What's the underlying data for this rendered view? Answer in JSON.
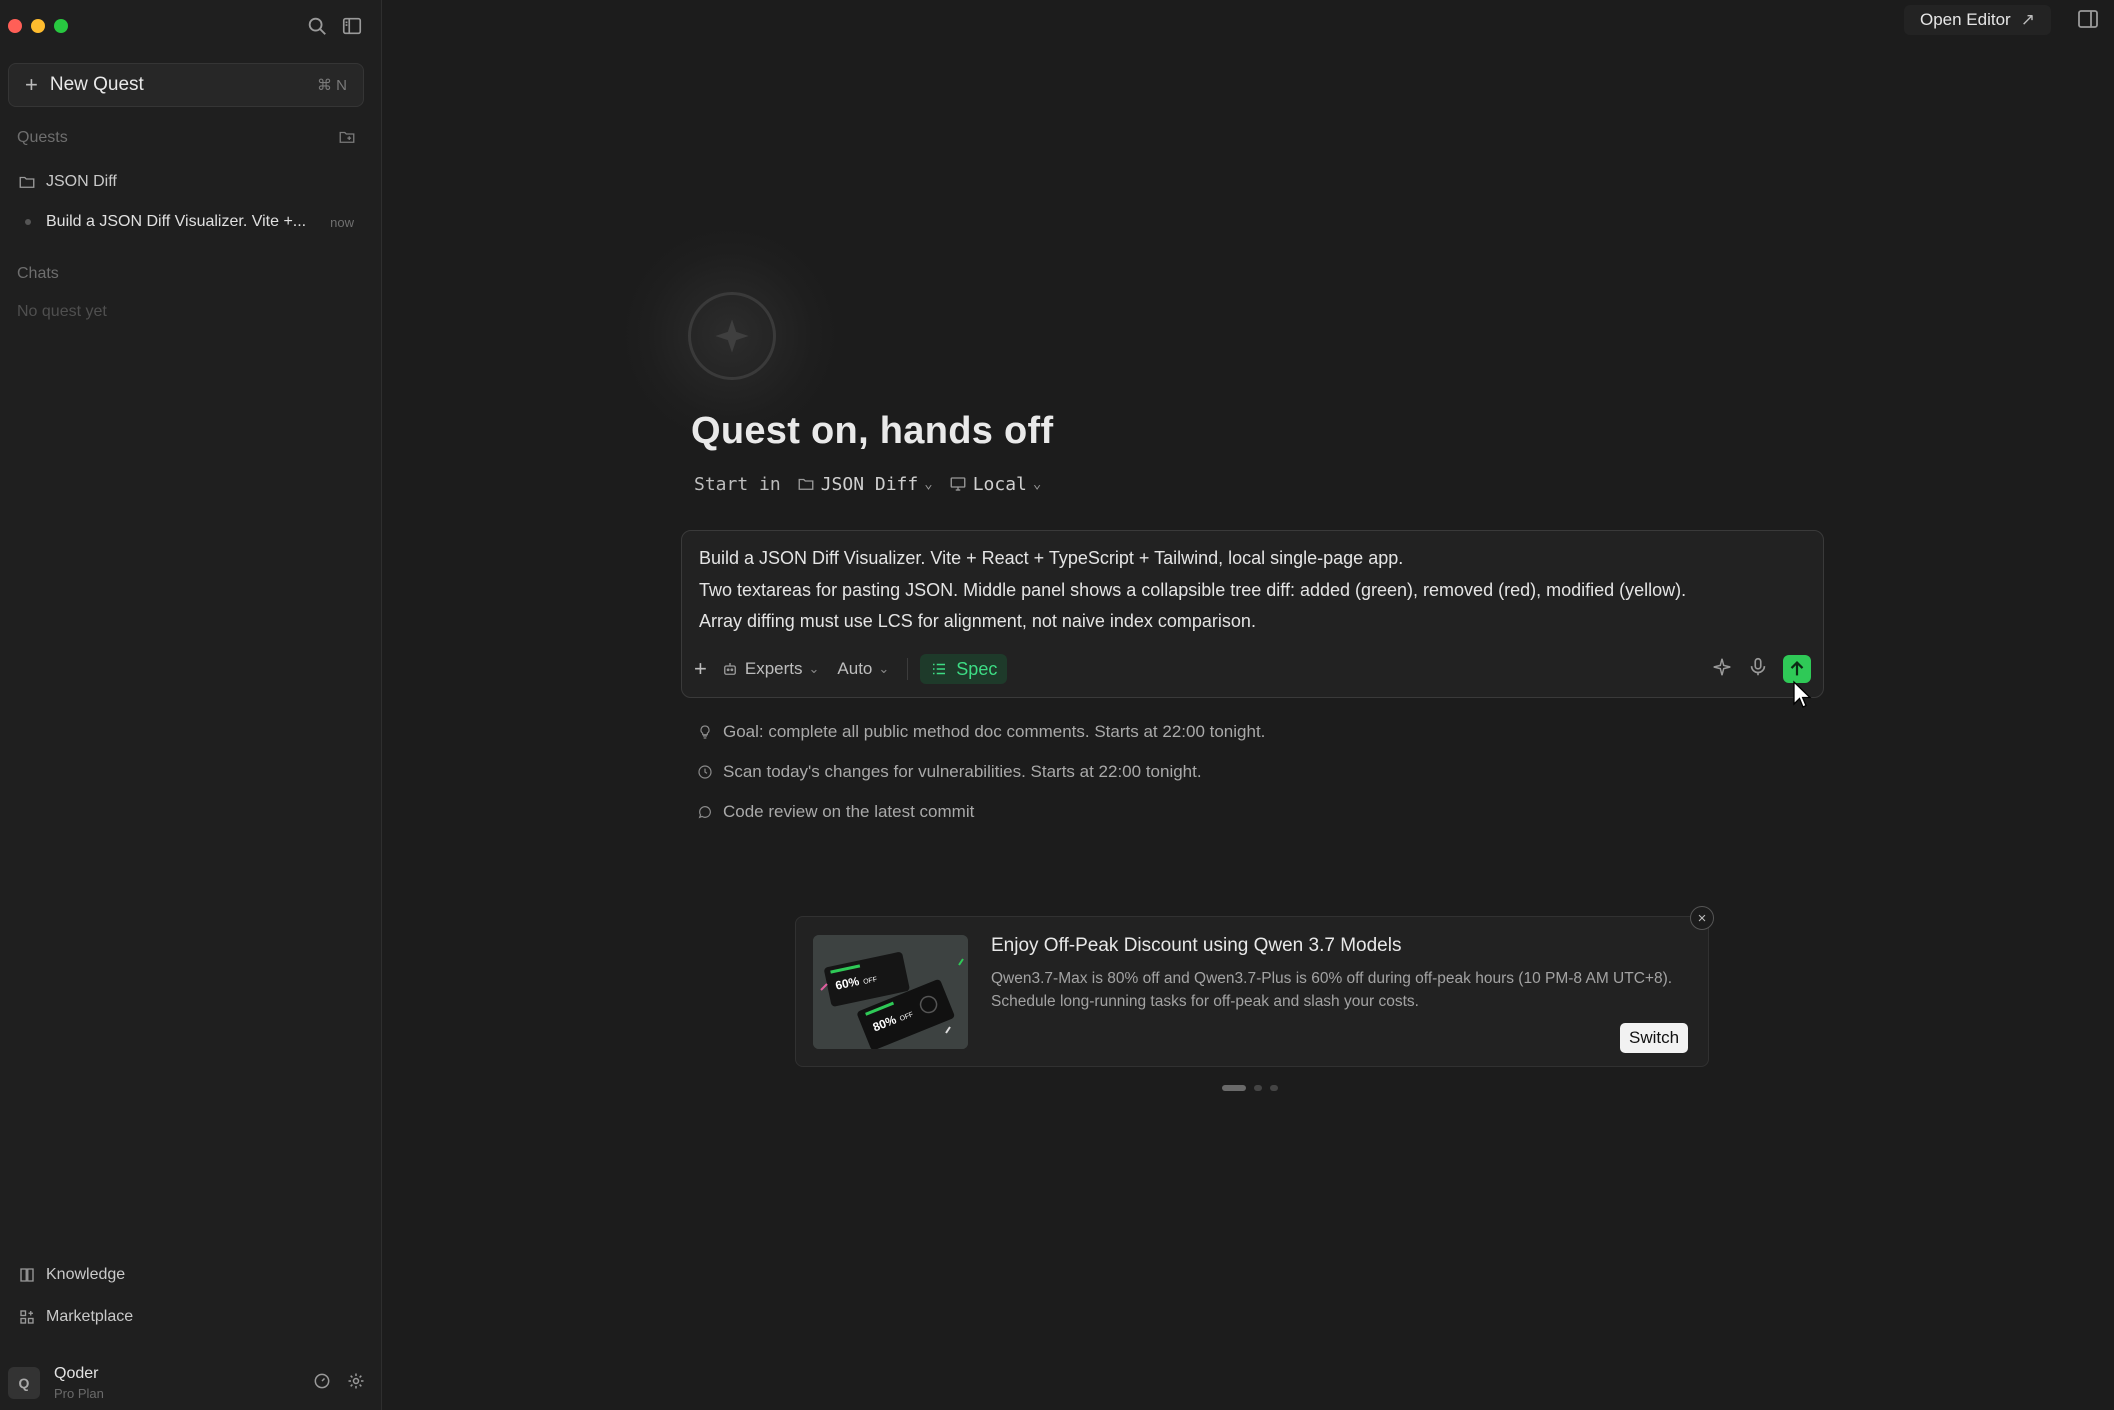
{
  "sidebar": {
    "new_quest": {
      "label": "New Quest",
      "shortcut": "⌘ N"
    },
    "quests_header": "Quests",
    "project": "JSON Diff",
    "quest": {
      "title": "Build a JSON Diff Visualizer. Vite +...",
      "time": "now"
    },
    "chats_header": "Chats",
    "chats_empty": "No quest yet",
    "knowledge": "Knowledge",
    "marketplace": "Marketplace",
    "user": {
      "initial": "Q",
      "name": "Qoder",
      "plan": "Pro Plan"
    }
  },
  "topbar": {
    "open_editor": "Open Editor"
  },
  "hero": {
    "headline": "Quest on, hands off",
    "start_in": "Start in",
    "project": "JSON Diff",
    "env": "Local"
  },
  "composer": {
    "lines": [
      "Build a JSON Diff Visualizer. Vite + React + TypeScript + Tailwind, local single-page app.",
      "Two textareas for pasting JSON. Middle panel shows a collapsible tree diff: added (green), removed (red), modified (yellow).",
      "Array diffing must use LCS for alignment, not naive index comparison."
    ],
    "experts": "Experts",
    "mode": "Auto",
    "spec": "Spec"
  },
  "suggestions": [
    {
      "icon": "lightbulb-icon",
      "text": "Goal: complete all public method doc comments. Starts at 22:00 tonight."
    },
    {
      "icon": "clock-icon",
      "text": "Scan today's changes for vulnerabilities. Starts at 22:00 tonight."
    },
    {
      "icon": "chat-icon",
      "text": "Code review on the latest commit"
    }
  ],
  "promo": {
    "title": "Enjoy Off-Peak Discount using Qwen 3.7 Models",
    "body": "Qwen3.7-Max is 80% off and Qwen3.7-Plus is 60% off during off-peak hours (10 PM-8 AM UTC+8). Schedule long-running tasks for off-peak and slash your costs.",
    "switch": "Switch",
    "img_text_1": "60%",
    "img_text_2": "80%",
    "img_off": "OFF"
  },
  "colors": {
    "accent_green": "#2fc957",
    "spec_text": "#3ddc84"
  }
}
